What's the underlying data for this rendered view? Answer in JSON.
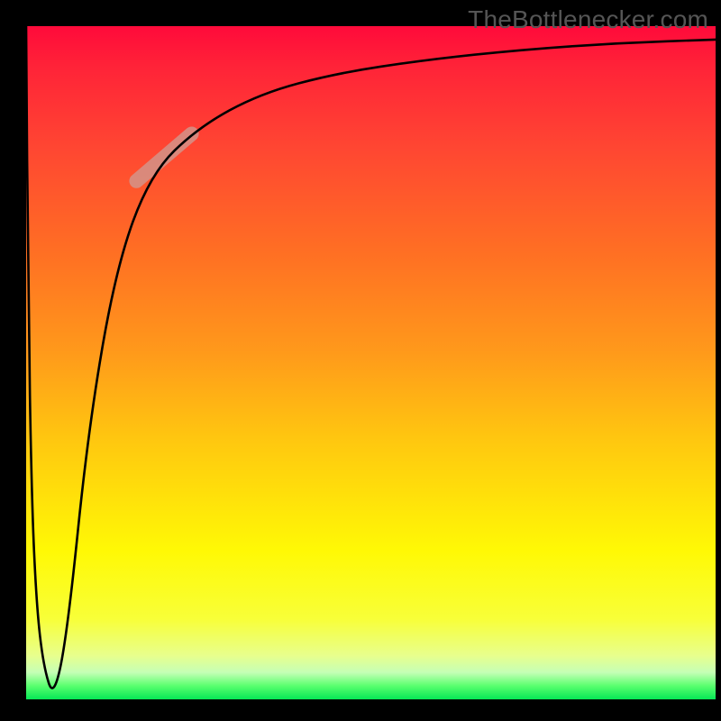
{
  "watermark": "TheBottlenecker.com",
  "chart_data": {
    "type": "line",
    "title": "",
    "xlabel": "",
    "ylabel": "",
    "xlim": [
      0,
      100
    ],
    "ylim": [
      0,
      100
    ],
    "series": [
      {
        "name": "curve",
        "x": [
          0,
          0.3,
          0.8,
          1.5,
          2.5,
          4,
          6,
          9,
          13,
          18,
          25,
          34,
          45,
          58,
          72,
          86,
          100
        ],
        "values": [
          100,
          60,
          30,
          14,
          5,
          0,
          10,
          40,
          64,
          78,
          85,
          90,
          93,
          95,
          96.5,
          97.5,
          98
        ]
      }
    ],
    "highlight_segment": {
      "x_start": 16,
      "x_end": 24,
      "y_start": 77,
      "y_end": 84
    }
  },
  "colors": {
    "gradient_top": "#ff0a3a",
    "gradient_mid": "#ffe100",
    "gradient_bottom": "#06e756",
    "curve": "#000000",
    "highlight": "#d2968c",
    "background": "#000000",
    "watermark": "#555555"
  }
}
